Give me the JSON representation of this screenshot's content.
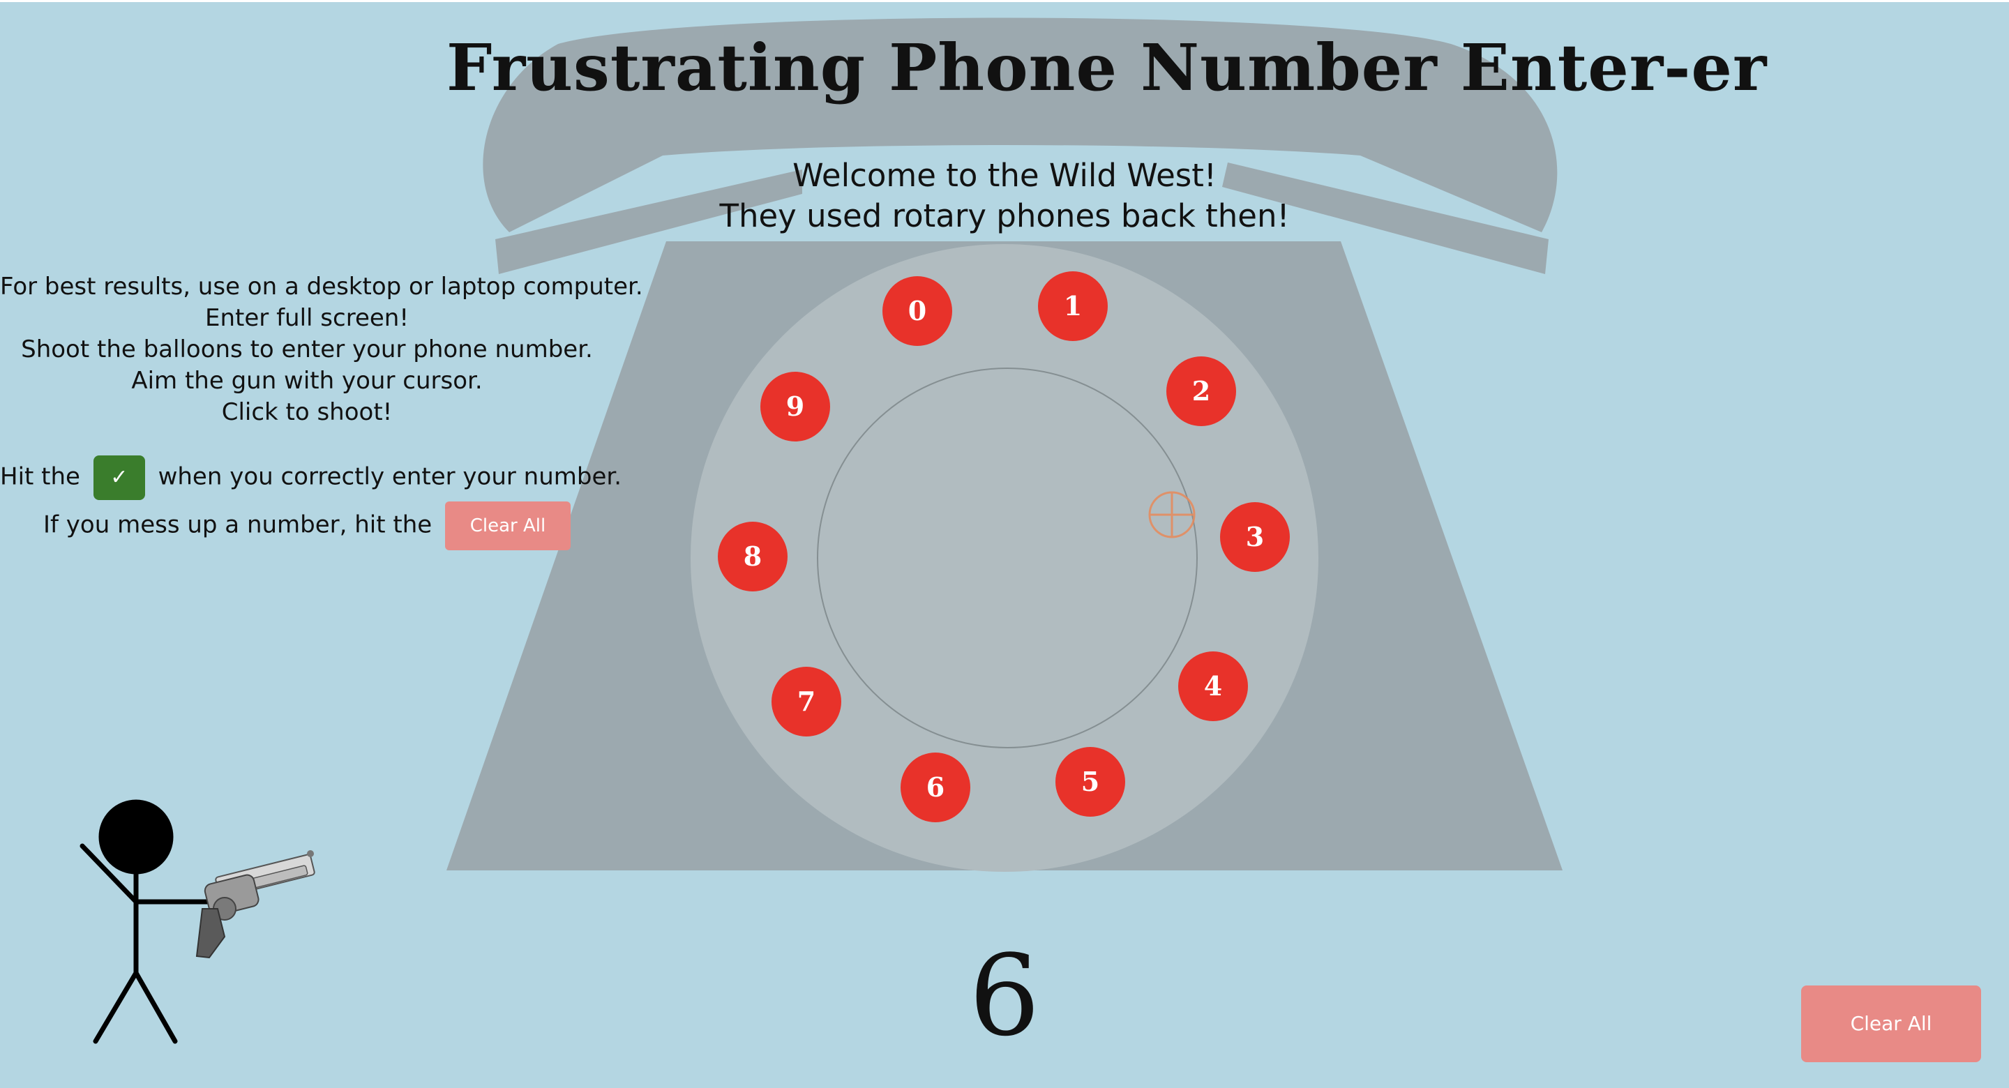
{
  "title": "Frustrating Phone Number Enter-er",
  "welcome": {
    "line1": "Welcome to the Wild West!",
    "line2": "They used rotary phones back then!"
  },
  "instructions": {
    "lines": [
      "For best results, use on a desktop or laptop computer.",
      "Enter full screen!",
      "Shoot the balloons to enter your phone number.",
      "Aim the gun with your cursor.",
      "Click to shoot!"
    ],
    "hit_before": "Hit the",
    "check_symbol": "✓",
    "hit_after": "when you correctly enter your number.",
    "mess_text": "If you mess up a number, hit the",
    "clear_inline_label": "Clear All"
  },
  "balloons": [
    "0",
    "1",
    "2",
    "3",
    "4",
    "5",
    "6",
    "7",
    "8",
    "9"
  ],
  "entered_number": "6",
  "clear_button_label": "Clear All",
  "colors": {
    "background": "#b4d6e2",
    "phone_body": "#9ca9af",
    "dial": "#b1bcc0",
    "balloon": "#e8322a",
    "check_button": "#3a7d2c",
    "clear_button": "#e88a86",
    "crosshair": "#e88a5a"
  },
  "icons": {
    "gun": "revolver-icon",
    "shooter": "stick-figure-icon",
    "aim": "crosshair-icon",
    "check": "checkmark-icon"
  }
}
